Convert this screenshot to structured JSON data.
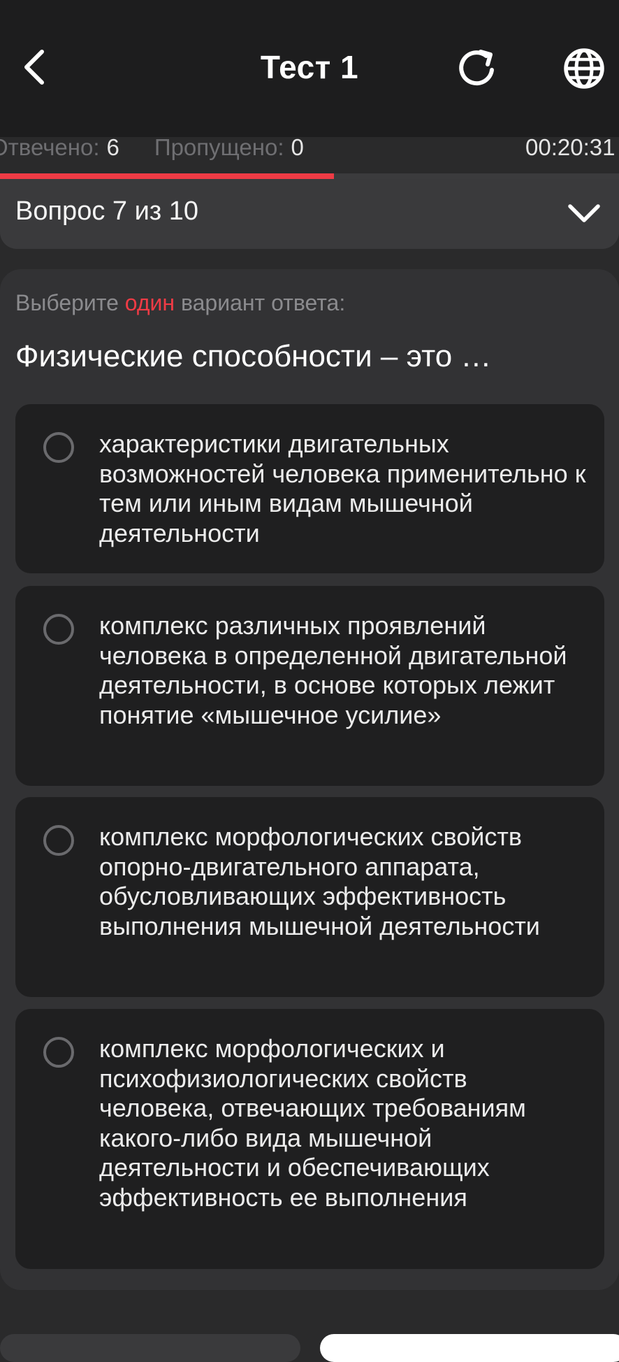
{
  "header": {
    "title": "Тест 1",
    "back_icon": "chevron-left-icon",
    "reload_icon": "refresh-icon",
    "language_icon": "globe-icon"
  },
  "stats": {
    "answered_label": "Отвечено:",
    "answered_value": "6",
    "skipped_label": "Пропущено:",
    "skipped_value": "0",
    "timer": "00:20:31"
  },
  "progress": {
    "answered": 6,
    "total": 10,
    "fraction": 0.6
  },
  "question_nav": {
    "label": "Вопрос 7 из 10",
    "toggle_icon": "chevron-down-icon"
  },
  "question": {
    "instruction_prefix": "Выберите",
    "instruction_accent": "один",
    "instruction_suffix": "вариант ответа:",
    "text": "Физические способности – это …",
    "options": [
      {
        "text": "характеристики двигательных возможностей человека применительно к тем или иным видам мышечной деятельности",
        "selected": false
      },
      {
        "text": "комплекс различных проявлений человека в определенной двигательной деятельности, в основе которых лежит понятие «мышечное усилие»",
        "selected": false
      },
      {
        "text": "комплекс морфологических свойств опорно-двигательного аппарата, обусловливающих эффективность выполнения мышечной деятельности",
        "selected": false
      },
      {
        "text": "комплекс морфологических и психофизиологических свойств человека, отвечающих требованиям какого-либо вида мышечной деятельности и обеспечивающих эффективность ее выполнения",
        "selected": false
      }
    ]
  },
  "colors": {
    "accent": "#ef3b45",
    "background": "#2a2a2b",
    "header_background": "#1d1d1e",
    "option_background": "#1f1f20"
  }
}
